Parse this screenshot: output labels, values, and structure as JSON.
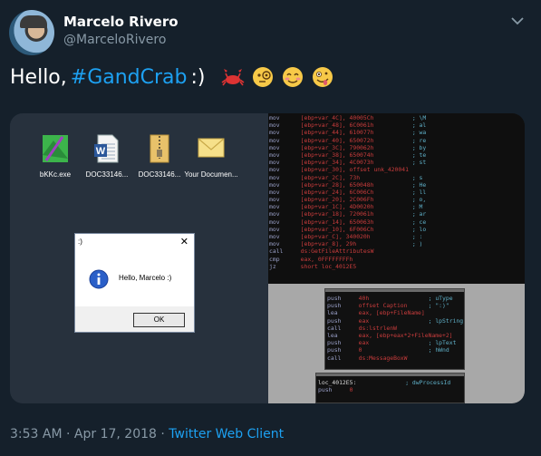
{
  "author": {
    "name": "Marcelo Rivero",
    "handle": "@MarceloRivero"
  },
  "tweet": {
    "greeting": "Hello,",
    "hashtag": "#GandCrab",
    "smiley": ":)",
    "emojis": [
      "crab-emoji",
      "monocle-face-emoji",
      "smiling-face-emoji",
      "zany-face-emoji"
    ]
  },
  "desktop_icons": [
    {
      "label": "bKKc.exe",
      "icon": "exe-icon"
    },
    {
      "label": "DOC33146...",
      "icon": "word-doc-icon"
    },
    {
      "label": "DOC33146...",
      "icon": "zip-folder-icon"
    },
    {
      "label": "Your Documen...",
      "icon": "envelope-icon"
    }
  ],
  "dialog": {
    "title": ":)",
    "close": "✕",
    "message": "Hello, Marcelo :)",
    "ok_label": "OK"
  },
  "ida_main": [
    [
      "mov",
      "[ebp+var_4C], 40005Ch",
      "; \\M"
    ],
    [
      "mov",
      "[ebp+var_48], 6C0061h",
      "; al"
    ],
    [
      "mov",
      "[ebp+var_44], 610077h",
      "; wa"
    ],
    [
      "mov",
      "[ebp+var_40], 650072h",
      "; re"
    ],
    [
      "mov",
      "[ebp+var_3C], 790062h",
      "; by"
    ],
    [
      "mov",
      "[ebp+var_38], 650074h",
      "; te"
    ],
    [
      "mov",
      "[ebp+var_34], 4C0073h",
      "; st"
    ],
    [
      "mov",
      "[ebp+var_30], offset unk_420041",
      ""
    ],
    [
      "mov",
      "[ebp+var_2C], 73h",
      "; s"
    ],
    [
      "mov",
      "[ebp+var_28], 650048h",
      "; He"
    ],
    [
      "mov",
      "[ebp+var_24], 6C006Ch",
      "; ll"
    ],
    [
      "mov",
      "[ebp+var_20], 2C006Fh",
      "; o,"
    ],
    [
      "mov",
      "[ebp+var_1C], 4D0020h",
      "; M"
    ],
    [
      "mov",
      "[ebp+var_18], 720061h",
      "; ar"
    ],
    [
      "mov",
      "[ebp+var_14], 650063h",
      "; ce"
    ],
    [
      "mov",
      "[ebp+var_10], 6F006Ch",
      "; lo"
    ],
    [
      "mov",
      "[ebp+var_C], 340020h",
      "; :"
    ],
    [
      "mov",
      "[ebp+var_8], 29h",
      "; )"
    ],
    [
      "call",
      "ds:GetFileAttributesW",
      ""
    ],
    [
      "cmp",
      "eax, 0FFFFFFFFh",
      ""
    ],
    [
      "jz",
      "short loc_4012E5",
      ""
    ]
  ],
  "ida_block": [
    [
      "push",
      "40h",
      "; uType"
    ],
    [
      "push",
      "offset Caption",
      "; \":)\""
    ],
    [
      "lea",
      "eax, [ebp+FileName]",
      ""
    ],
    [
      "push",
      "eax",
      "; lpString"
    ],
    [
      "call",
      "ds:lstrlenW",
      ""
    ],
    [
      "lea",
      "eax, [ebp+eax*2+FileName+2]",
      ""
    ],
    [
      "push",
      "eax",
      "; lpText"
    ],
    [
      "push",
      "0",
      "; hWnd"
    ],
    [
      "call",
      "ds:MessageBoxW",
      ""
    ]
  ],
  "ida_loc": [
    [
      "loc_4012E5:",
      "",
      "; dwProcessId"
    ],
    [
      "push",
      "0",
      ""
    ]
  ],
  "footer": {
    "time": "3:53 AM",
    "date": "Apr 17, 2018",
    "sep": "·",
    "client": "Twitter Web Client"
  },
  "colors": {
    "background": "#15202b",
    "link": "#1da1f2",
    "muted": "#8899a6"
  }
}
